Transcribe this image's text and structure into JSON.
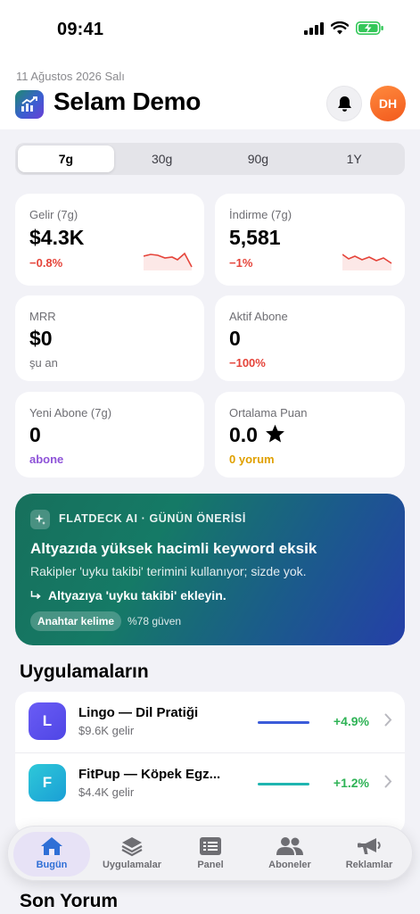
{
  "status_bar": {
    "time": "09:41"
  },
  "header": {
    "date": "11 Ağustos 2026 Salı",
    "greeting": "Selam Demo",
    "avatar_initials": "DH"
  },
  "range_tabs": [
    {
      "label": "7g",
      "active": true
    },
    {
      "label": "30g",
      "active": false
    },
    {
      "label": "90g",
      "active": false
    },
    {
      "label": "1Y",
      "active": false
    }
  ],
  "metrics": {
    "revenue": {
      "label": "Gelir (7g)",
      "value": "$4.3K",
      "change": "−0.8%"
    },
    "downloads": {
      "label": "İndirme (7g)",
      "value": "5,581",
      "change": "−1%"
    },
    "mrr": {
      "label": "MRR",
      "value": "$0",
      "note": "şu an"
    },
    "active_subs": {
      "label": "Aktif Abone",
      "value": "0",
      "change": "−100%"
    },
    "new_subs": {
      "label": "Yeni Abone (7g)",
      "value": "0",
      "note": "abone"
    },
    "avg_rating": {
      "label": "Ortalama Puan",
      "value": "0.0",
      "note": "0 yorum"
    }
  },
  "insight": {
    "kicker": "FLATDECK AI · GÜNÜN ÖNERİSİ",
    "title": "Altyazıda yüksek hacimli keyword eksik",
    "description": "Rakipler 'uyku takibi' terimini kullanıyor; sizde yok.",
    "action": "Altyazıya 'uyku takibi' ekleyin.",
    "tag": "Anahtar kelime",
    "confidence": "%78 güven"
  },
  "apps_section": {
    "title": "Uygulamaların",
    "apps": [
      {
        "initial": "L",
        "name": "Lingo — Dil Pratiği",
        "revenue": "$9.6K gelir",
        "change": "+4.9%",
        "color": "#5b5bf0",
        "spark_color": "#3b5bd9"
      },
      {
        "initial": "F",
        "name": "FitPup — Köpek Egz...",
        "revenue": "$4.4K gelir",
        "change": "+1.2%",
        "color": "#22b8cf",
        "spark_color": "#1fb5b0"
      }
    ]
  },
  "reviews_section": {
    "title": "Son Yorum"
  },
  "tab_bar": [
    {
      "label": "Bugün",
      "icon": "home-icon",
      "active": true
    },
    {
      "label": "Uygulamalar",
      "icon": "layers-icon",
      "active": false
    },
    {
      "label": "Panel",
      "icon": "panel-icon",
      "active": false
    },
    {
      "label": "Aboneler",
      "icon": "people-icon",
      "active": false
    },
    {
      "label": "Reklamlar",
      "icon": "megaphone-icon",
      "active": false
    }
  ],
  "colors": {
    "accent": "#2f6fd6",
    "negative": "#e5443a",
    "positive": "#2fb356",
    "avatar": "#f25a1d"
  }
}
